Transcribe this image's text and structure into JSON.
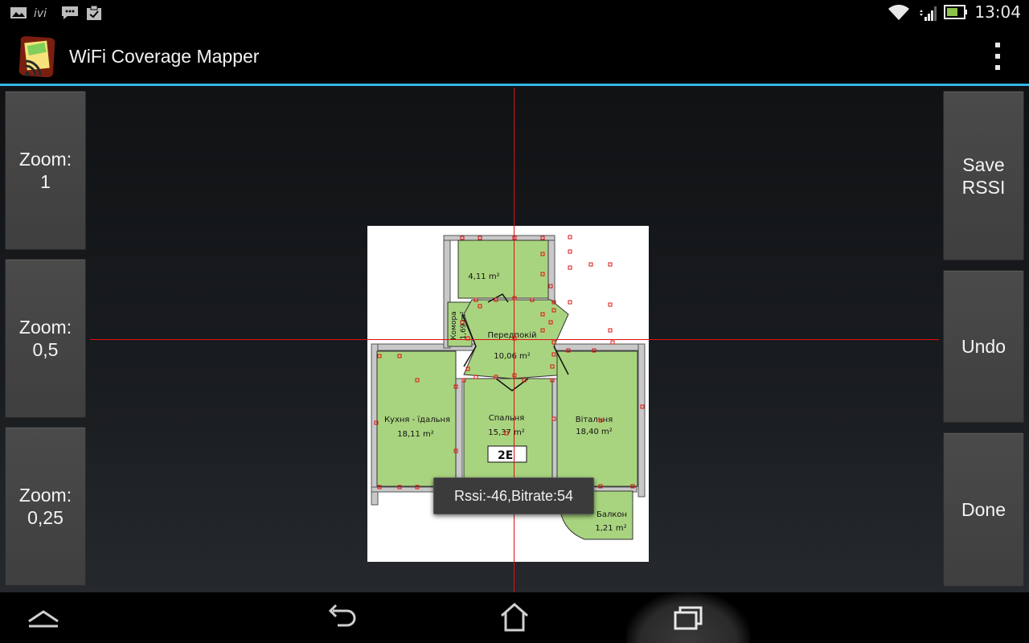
{
  "status_bar": {
    "notification_icons": [
      "image-icon",
      "ivi-icon",
      "chat-icon",
      "clipboard-icon"
    ],
    "system_icons": [
      "wifi-icon",
      "signal-icon",
      "battery-icon"
    ],
    "time": "13:04"
  },
  "action_bar": {
    "title": "WiFi Coverage Mapper",
    "accent_color": "#33b5e5"
  },
  "left_buttons": [
    {
      "label": "Zoom:\n1"
    },
    {
      "label": "Zoom:\n0,5"
    },
    {
      "label": "Zoom:\n0,25"
    }
  ],
  "right_buttons": [
    {
      "label": "Save\nRSSI"
    },
    {
      "label": "Undo"
    },
    {
      "label": "Done"
    }
  ],
  "floor_plan": {
    "rooms": [
      {
        "name": "",
        "area": "4,11 m²"
      },
      {
        "name": "Комора",
        "area": "1,69 m²"
      },
      {
        "name": "Передпокій",
        "area": "10,06 m²"
      },
      {
        "name": "Кухня - їдальня",
        "area": "18,11 m²"
      },
      {
        "name": "Спальня",
        "area": "15,37 m²"
      },
      {
        "name": "Вітальня",
        "area": "18,40 m²"
      },
      {
        "name": "Балкон",
        "area": "1,21 m²"
      }
    ],
    "plan_label": "2E",
    "crosshair_color": "#e01010",
    "marker_color": "#e01010"
  },
  "toast": {
    "text": "Rssi:-46,Bitrate:54"
  },
  "nav_bar": {
    "buttons": [
      "up-icon",
      "back-icon",
      "home-icon",
      "recents-icon"
    ]
  }
}
